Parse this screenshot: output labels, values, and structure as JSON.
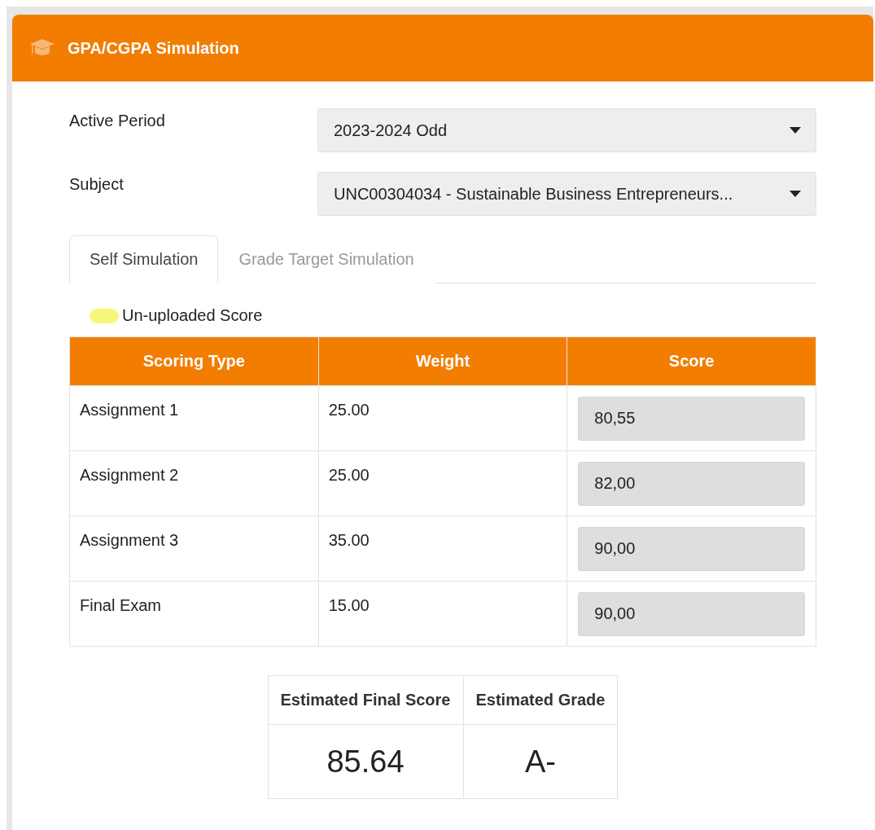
{
  "card": {
    "title": "GPA/CGPA Simulation"
  },
  "fields": [
    {
      "label": "Active Period",
      "value": "2023-2024 Odd"
    },
    {
      "label": "Subject",
      "value": "UNC00304034 - Sustainable Business Entrepreneurs..."
    }
  ],
  "tabs": [
    {
      "label": "Self Simulation",
      "selected": true
    },
    {
      "label": "Grade Target Simulation",
      "selected": false
    }
  ],
  "legend": {
    "label": "Un-uploaded Score"
  },
  "table": {
    "columns": [
      "Scoring Type",
      "Weight",
      "Score"
    ],
    "rows": [
      {
        "type": "Assignment 1",
        "weight": "25.00",
        "score": "80,55"
      },
      {
        "type": "Assignment 2",
        "weight": "25.00",
        "score": "82,00"
      },
      {
        "type": "Assignment 3",
        "weight": "35.00",
        "score": "90,00"
      },
      {
        "type": "Final Exam",
        "weight": "15.00",
        "score": "90,00"
      }
    ]
  },
  "summary": {
    "columns": [
      "Estimated Final Score",
      "Estimated Grade"
    ],
    "values": [
      "85.64",
      "A-"
    ]
  }
}
